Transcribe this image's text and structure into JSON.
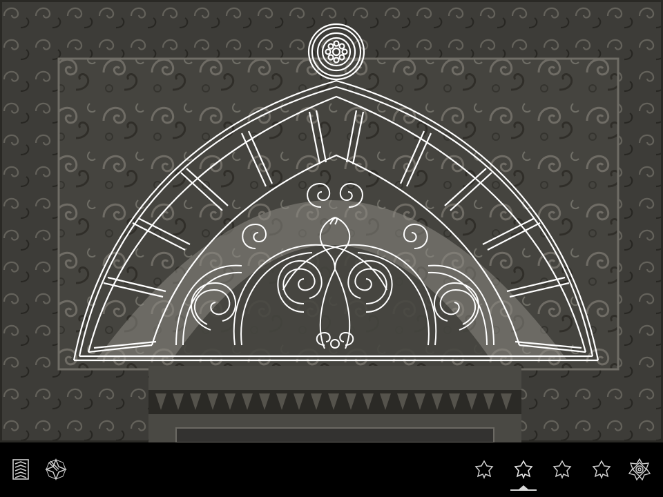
{
  "viewer": {
    "background": "carved-marble-portal-photo",
    "overlay": "arch-tympanum-line-drawing",
    "overlay_color": "#ffffff"
  },
  "toolbar": {
    "left": [
      {
        "id": "menu",
        "icon": "stacked-chevrons-icon"
      },
      {
        "id": "compass",
        "icon": "compass-star-icon"
      }
    ],
    "right": [
      {
        "id": "pattern-1",
        "icon": "eight-point-star-icon"
      },
      {
        "id": "pattern-2",
        "icon": "eight-point-star-icon",
        "active": true
      },
      {
        "id": "pattern-3",
        "icon": "eight-point-star-icon"
      },
      {
        "id": "pattern-4",
        "icon": "eight-point-star-icon"
      },
      {
        "id": "pattern-5",
        "icon": "ornate-rosette-icon"
      }
    ],
    "active_indicator_color": "#d8d8d8"
  }
}
